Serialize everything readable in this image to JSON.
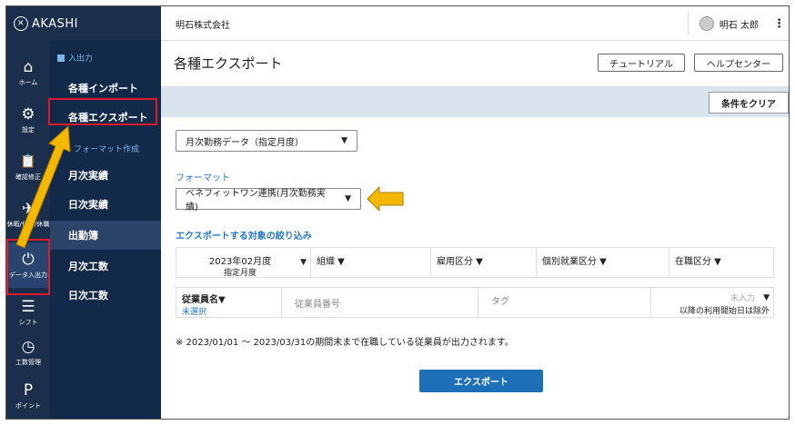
{
  "brand": {
    "name": "AKASHI"
  },
  "rail": [
    {
      "icon": "⌂",
      "label": "ホーム"
    },
    {
      "icon": "⚙",
      "label": "設定"
    },
    {
      "icon": "📋",
      "label": "確認修正"
    },
    {
      "icon": "✈",
      "label": "休暇/休日/休職"
    },
    {
      "icon": "⏻",
      "label": "データ入出力"
    },
    {
      "icon": "☰",
      "label": "シフト"
    },
    {
      "icon": "◷",
      "label": "工数管理"
    },
    {
      "icon": "P",
      "label": "ポイント"
    }
  ],
  "submenu": {
    "section1": "入出力",
    "items1": [
      "各種インポート",
      "各種エクスポート"
    ],
    "section2": "フォーマット作成",
    "items2": [
      "月次実績",
      "日次実績",
      "出勤簿",
      "月次工数",
      "日次工数"
    ]
  },
  "topbar": {
    "company": "明石株式会社",
    "user": "明石 太郎",
    "more": "⋮"
  },
  "main": {
    "title": "各種エクスポート",
    "tutorial": "チュートリアル",
    "help": "ヘルプセンター",
    "clear": "条件をクリア",
    "data_select": "月次勤務データ（指定月度）",
    "format_label": "フォーマット",
    "format_select": "ベネフィットワン連携(月次勤務実績)",
    "filter_label": "エクスポートする対象の絞り込み",
    "month": "2023年02月度",
    "month_sub": "指定月度",
    "org": "組織",
    "employment": "雇用区分",
    "work_type": "個別就業区分",
    "status": "在職区分",
    "emp_name": "従業員名",
    "emp_name_sub": "未選択",
    "emp_no": "従業員番号",
    "tag": "タグ",
    "not_entered": "未入力",
    "exclude": "以降の利用開始日は除外",
    "note": "※ 2023/01/01 ～ 2023/03/31の期間末まで在職している従業員が出力されます。",
    "export": "エクスポート"
  },
  "colors": {
    "sidebar": "#1b2f4d",
    "submenu": "#12294a",
    "accent": "#1d70b8",
    "highlight": "#e0192b",
    "arrow": "#f5b800"
  }
}
